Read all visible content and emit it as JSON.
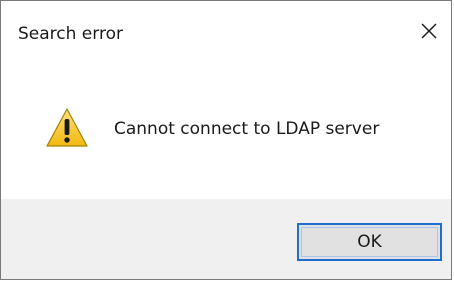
{
  "dialog": {
    "title": "Search error",
    "message": "Cannot connect to LDAP server",
    "ok_label": "OK",
    "icons": {
      "close": "close-icon",
      "warning": "warning-icon"
    },
    "colors": {
      "warning_fill": "#f6c21c",
      "focus_border": "#1f6fd0",
      "footer_bg": "#f0f0f0"
    }
  }
}
